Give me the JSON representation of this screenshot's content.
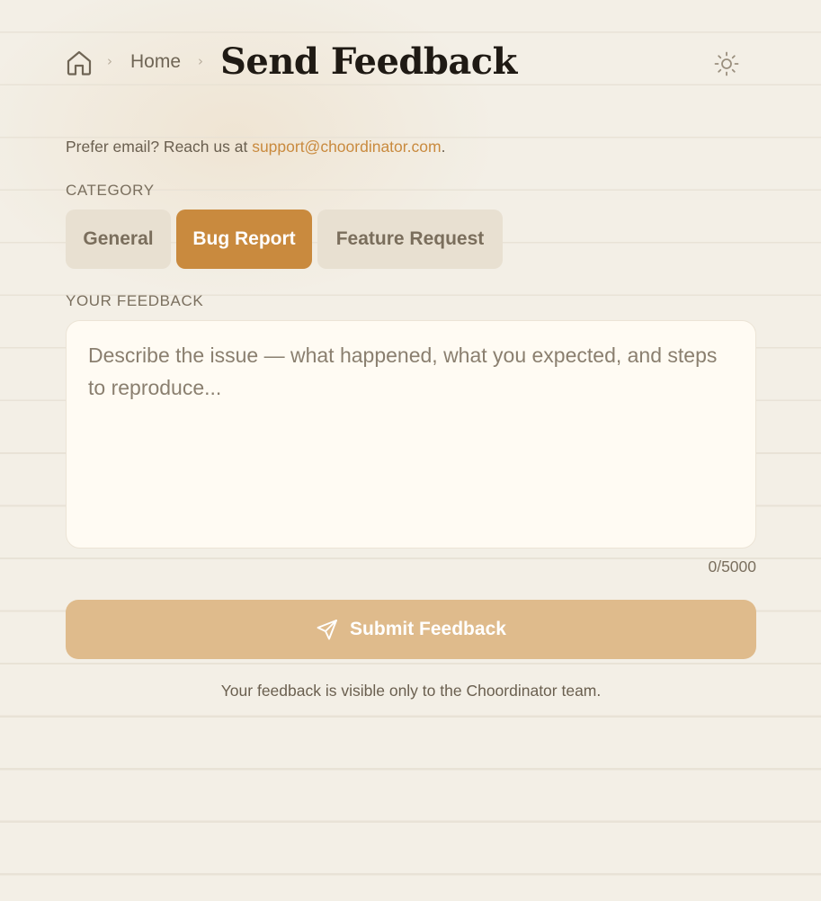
{
  "header": {
    "breadcrumb_separator": "›",
    "home_label": "Home",
    "title": "Send Feedback"
  },
  "contact": {
    "prefix": "Prefer email? Reach us at ",
    "email": "support@choordinator.com",
    "suffix": "."
  },
  "category": {
    "label": "CATEGORY",
    "options": [
      "General",
      "Bug Report",
      "Feature Request"
    ],
    "selected": "Bug Report"
  },
  "feedback": {
    "label": "YOUR FEEDBACK",
    "value": "",
    "placeholder": "Describe the issue — what happened, what you expected, and steps to reproduce...",
    "counter": "0/5000"
  },
  "submit": {
    "label": "Submit Feedback"
  },
  "footer": {
    "note": "Your feedback is visible only to the Choordinator team."
  },
  "colors": {
    "accent": "#c98a3e",
    "submit_disabled": "#dfbb8c",
    "background": "#f3efe6"
  },
  "icons": {
    "home": "home-icon",
    "theme": "sun-icon",
    "submit": "send-icon"
  }
}
